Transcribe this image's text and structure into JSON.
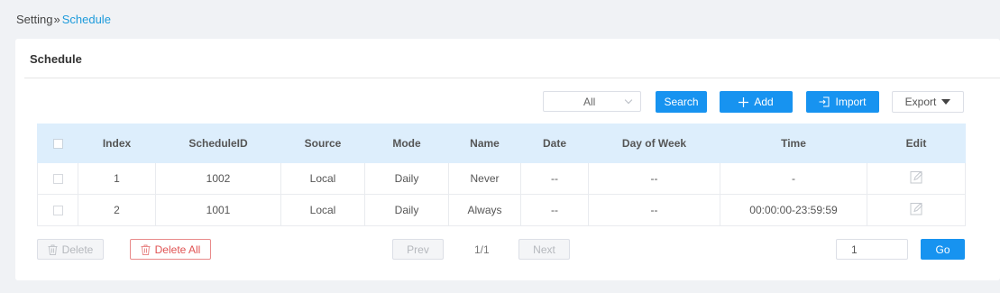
{
  "breadcrumb": {
    "root": "Setting",
    "separator": "»",
    "current": "Schedule"
  },
  "panel": {
    "title": "Schedule"
  },
  "toolbar": {
    "filter_value": "All",
    "search_label": "Search",
    "add_label": "Add",
    "import_label": "Import",
    "export_label": "Export"
  },
  "table": {
    "columns": [
      "Index",
      "ScheduleID",
      "Source",
      "Mode",
      "Name",
      "Date",
      "Day of Week",
      "Time",
      "Edit"
    ],
    "rows": [
      {
        "index": "1",
        "schedule_id": "1002",
        "source": "Local",
        "mode": "Daily",
        "name": "Never",
        "date": "--",
        "day_of_week": "--",
        "time": "-"
      },
      {
        "index": "2",
        "schedule_id": "1001",
        "source": "Local",
        "mode": "Daily",
        "name": "Always",
        "date": "--",
        "day_of_week": "--",
        "time": "00:00:00-23:59:59"
      }
    ]
  },
  "footer": {
    "delete_label": "Delete",
    "delete_all_label": "Delete All",
    "prev_label": "Prev",
    "page_info": "1/1",
    "next_label": "Next",
    "page_input_value": "1",
    "go_label": "Go"
  },
  "colors": {
    "accent": "#1793f0",
    "header_bg": "#ddeefc",
    "danger": "#e05353",
    "link": "#1d9bdb"
  }
}
